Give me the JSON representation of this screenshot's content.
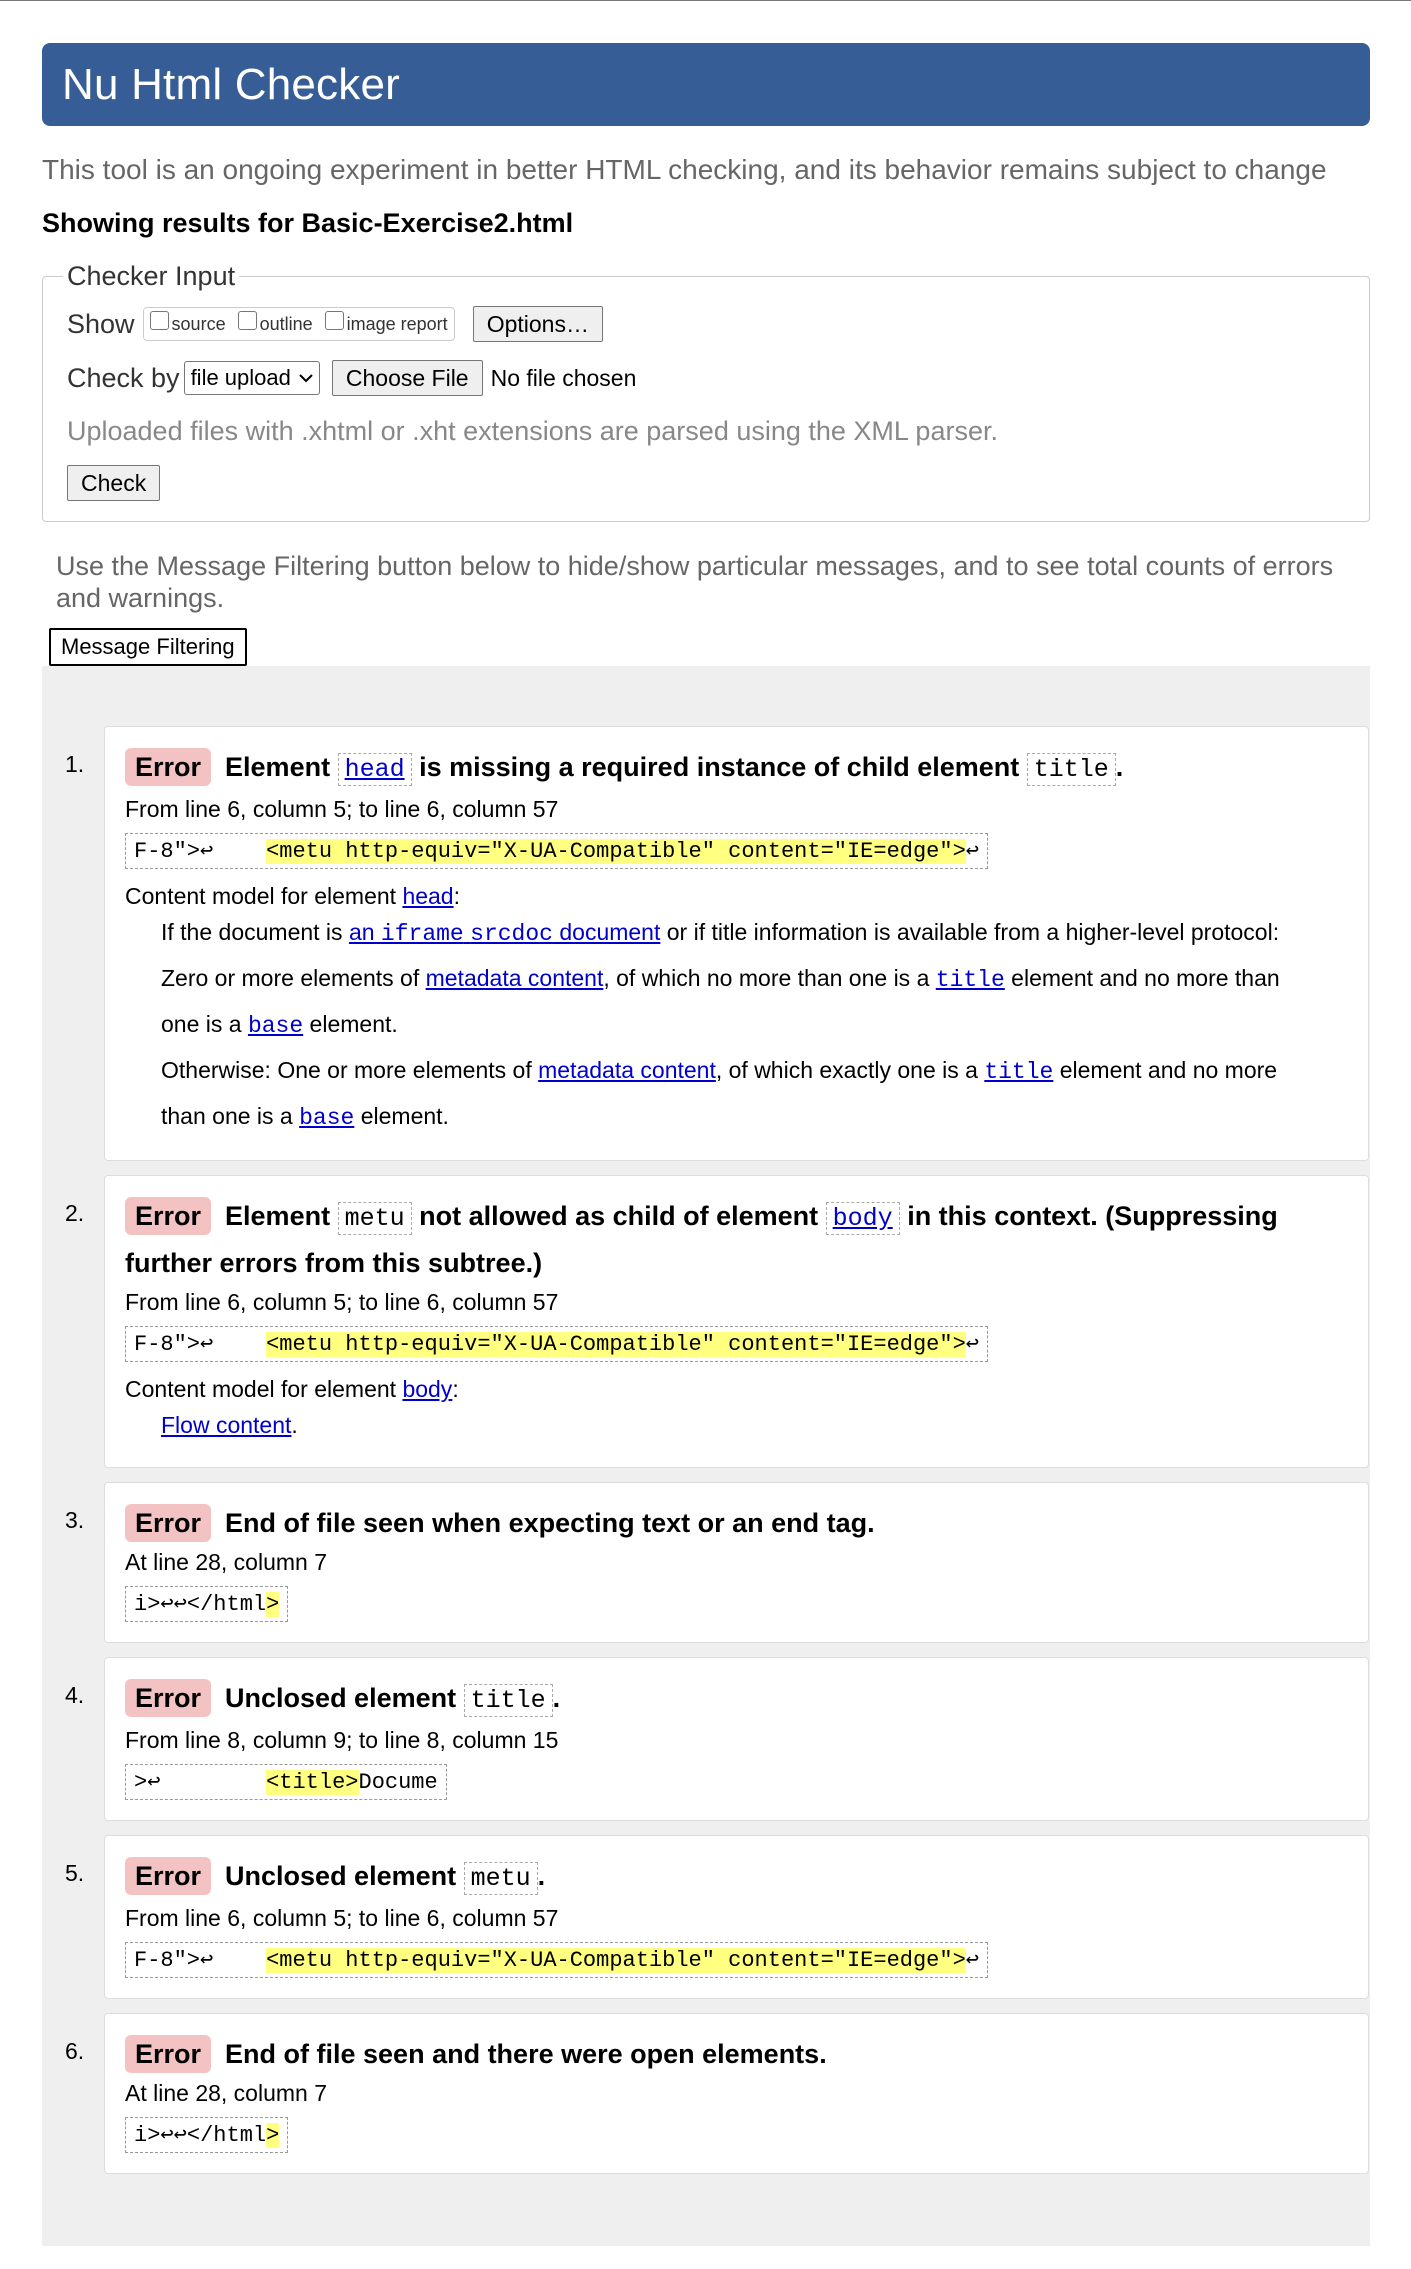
{
  "title": "Nu Html Checker",
  "tagline": "This tool is an ongoing experiment in better HTML checking, and its behavior remains subject to change",
  "showing": "Showing results for Basic-Exercise2.html",
  "checker": {
    "legend": "Checker Input",
    "show_label": "Show",
    "show_options": [
      "source",
      "outline",
      "image report"
    ],
    "options_button": "Options…",
    "check_by_label": "Check by",
    "check_by_value": "file upload",
    "choose_file": "Choose File",
    "no_file": "No file chosen",
    "hint": "Uploaded files with .xhtml or .xht extensions are parsed using the XML parser.",
    "check_button": "Check"
  },
  "filter": {
    "hint": "Use the Message Filtering button below to hide/show particular messages, and to see total counts of errors and warnings.",
    "button": "Message Filtering"
  },
  "messages": [
    {
      "num": "1.",
      "badge": "Error",
      "p1": "Element ",
      "c1": "head",
      "p2": " is missing a required instance of child element ",
      "c2": "title",
      "p3": ".",
      "loc": "From line 6, column 5; to line 6, column 57",
      "ex_pre": "F-8\">↩    ",
      "ex_hl": "<metu http-equiv=\"X-UA-Compatible\" content=\"IE=edge\">",
      "ex_post": "↩",
      "cm_label": "Content model for element ",
      "cm_link": "head",
      "cm_colon": ":",
      "s1_a": "If the document is ",
      "s1_l1": "an ",
      "s1_l2": "iframe",
      "s1_l3": " ",
      "s1_l4": "srcdoc",
      "s1_l5": " document",
      "s1_b": " or if title information is available from a higher-level protocol: Zero or more elements of ",
      "s1_l6": "metadata content",
      "s1_c": ", of which no more than one is a ",
      "s1_l7": "title",
      "s1_d": " element and no more than one is a ",
      "s1_l8": "base",
      "s1_e": " element.",
      "s2_a": "Otherwise: One or more elements of ",
      "s2_l1": "metadata content",
      "s2_b": ", of which exactly one is a ",
      "s2_l2": "title",
      "s2_c": " element and no more than one is a ",
      "s2_l3": "base",
      "s2_d": " element."
    },
    {
      "num": "2.",
      "badge": "Error",
      "p1": "Element ",
      "c1": "metu",
      "p2": " not allowed as child of element ",
      "c2": "body",
      "p3": " in this context. (Suppressing further errors from this subtree.)",
      "loc": "From line 6, column 5; to line 6, column 57",
      "ex_pre": "F-8\">↩    ",
      "ex_hl": "<metu http-equiv=\"X-UA-Compatible\" content=\"IE=edge\">",
      "ex_post": "↩",
      "cm_label": "Content model for element ",
      "cm_link": "body",
      "cm_colon": ":",
      "flow": "Flow content",
      "flow_dot": "."
    },
    {
      "num": "3.",
      "badge": "Error",
      "p1": "End of file seen when expecting text or an end tag.",
      "loc": "At line 28, column 7",
      "ex_pre": "i>↩↩</html",
      "ex_hl": ">",
      "ex_post": ""
    },
    {
      "num": "4.",
      "badge": "Error",
      "p1": "Unclosed element ",
      "c1": "title",
      "p3": ".",
      "loc": "From line 8, column 9; to line 8, column 15",
      "ex_pre": ">↩        ",
      "ex_hl": "<title>",
      "ex_post": "Docume"
    },
    {
      "num": "5.",
      "badge": "Error",
      "p1": "Unclosed element ",
      "c1": "metu",
      "p3": ".",
      "loc": "From line 6, column 5; to line 6, column 57",
      "ex_pre": "F-8\">↩    ",
      "ex_hl": "<metu http-equiv=\"X-UA-Compatible\" content=\"IE=edge\">",
      "ex_post": "↩"
    },
    {
      "num": "6.",
      "badge": "Error",
      "p1": "End of file seen and there were open elements.",
      "loc": "At line 28, column 7",
      "ex_pre": "i>↩↩</html",
      "ex_hl": ">",
      "ex_post": ""
    }
  ]
}
